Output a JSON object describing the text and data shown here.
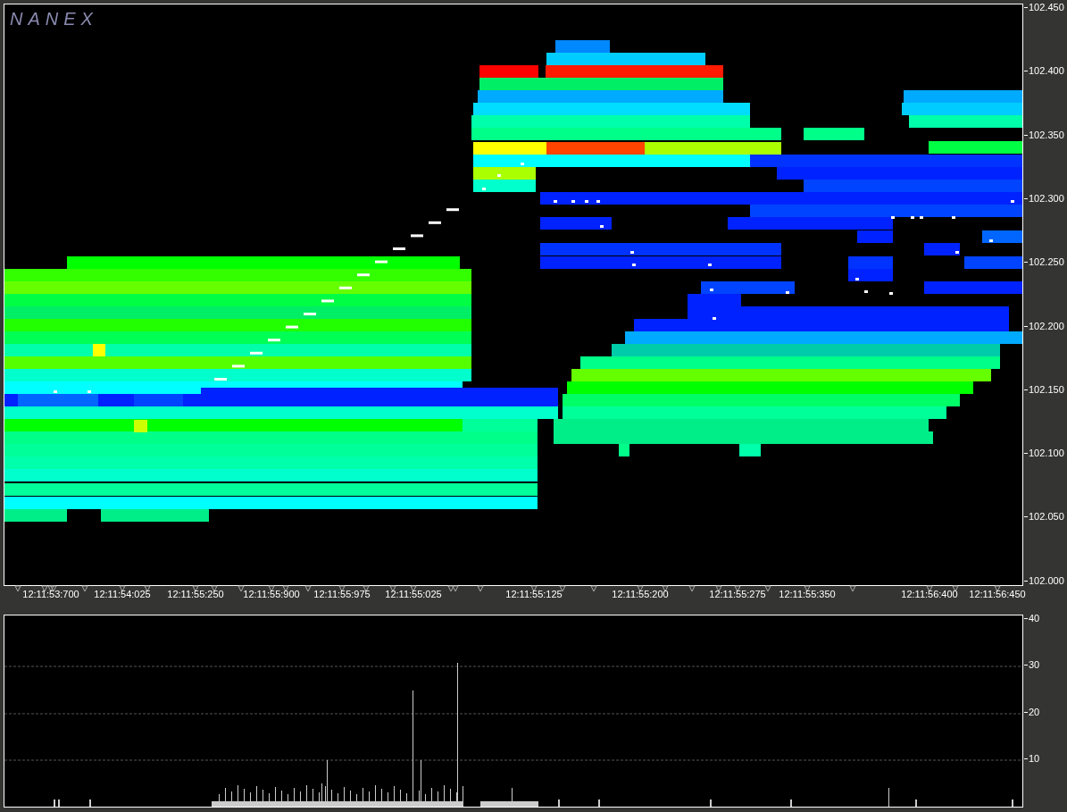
{
  "price_chart": {
    "logo": "NANEX",
    "y_axis_labels": [
      "102.450",
      "102.400",
      "102.350",
      "102.300",
      "102.250",
      "102.200",
      "102.150",
      "102.100",
      "102.050",
      "102.000"
    ],
    "x_axis_labels": [
      "12:11:53:700",
      "12:11:54:025",
      "12:11:55:250",
      "12:11:55:900",
      "12:11:55:975",
      "12:11:55:025",
      "12:11:55:125",
      "12:11:55:200",
      "12:11:55:275",
      "12:11:55:350",
      "12:11:56:400",
      "12:11:56:450"
    ]
  },
  "volume_chart": {
    "y_axis_labels": [
      "40",
      "30",
      "20",
      "10"
    ]
  }
}
